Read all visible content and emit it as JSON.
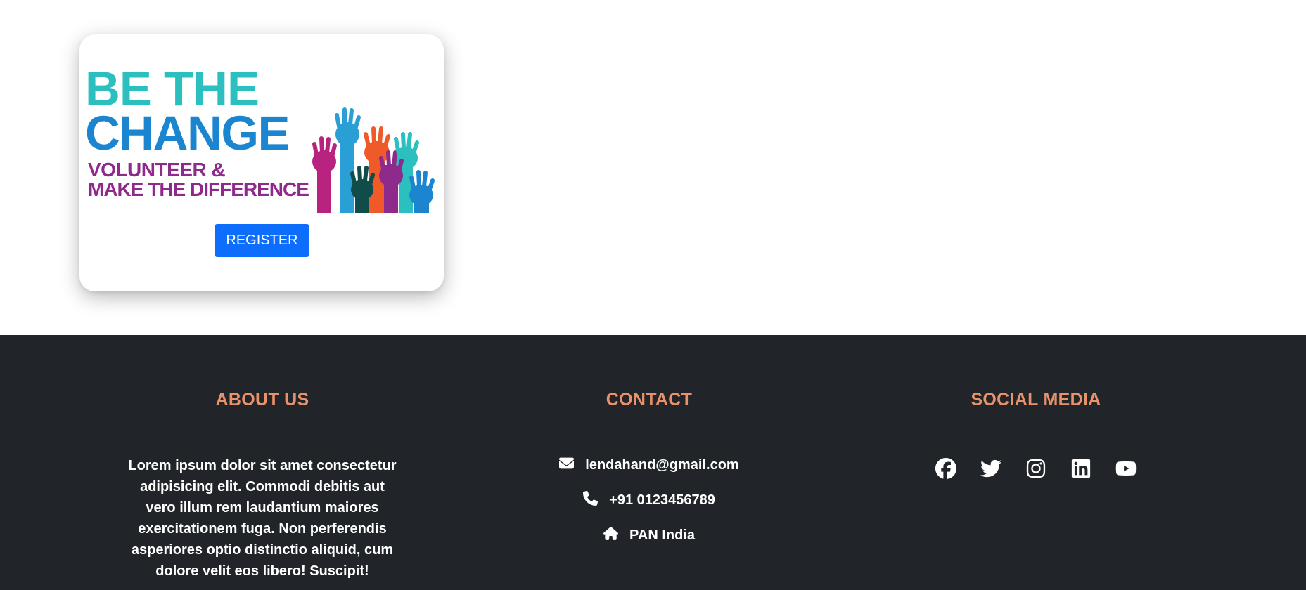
{
  "banner": {
    "line1": "BE THE",
    "line2": "CHANGE",
    "line3": "VOLUNTEER &",
    "line4": "MAKE THE DIFFERENCE"
  },
  "card": {
    "register_label": "REGISTER"
  },
  "footer": {
    "about": {
      "heading": "ABOUT US",
      "lines": [
        "Lorem ipsum dolor sit amet consectetur",
        "adipisicing elit. Commodi debitis aut",
        "vero illum rem laudantium maiores",
        "exercitationem fuga. Non perferendis",
        "asperiores optio distinctio aliquid, cum",
        "dolore velit eos libero! Suscipit!"
      ]
    },
    "contact": {
      "heading": "CONTACT",
      "email": "lendahand@gmail.com",
      "phone": "+91 0123456789",
      "location": "PAN India"
    },
    "social": {
      "heading": "SOCIAL MEDIA",
      "icons": [
        "facebook-icon",
        "twitter-icon",
        "instagram-icon",
        "linkedin-icon",
        "youtube-icon"
      ]
    }
  },
  "colors": {
    "heading_accent": "#e8916b",
    "footer_bg": "#212529",
    "button": "#0d6efd",
    "teal": "#2bbfbf",
    "blue": "#1b86cf",
    "purple": "#8e2a8c"
  }
}
